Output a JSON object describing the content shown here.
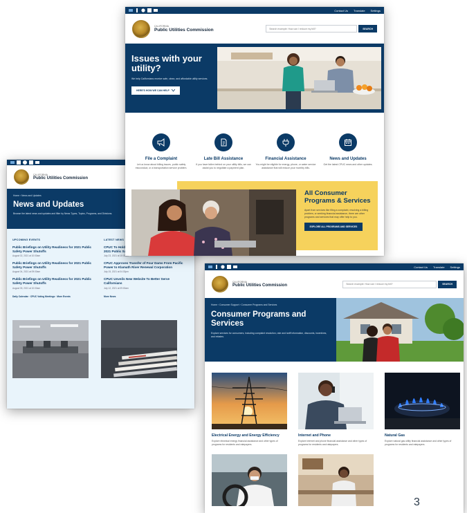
{
  "page_number": "3",
  "brand": {
    "state": "CALIFORNIA",
    "name": "Public Utilities Commission"
  },
  "utility_links": [
    "Contact Us",
    "Translate",
    "Settings"
  ],
  "search": {
    "placeholder": "Search example: How can I reduce my bill?",
    "button": "SEARCH"
  },
  "home": {
    "hero_title": "Issues with your utility?",
    "hero_text": "We help Californians receive safe, clean, and affordable utility services.",
    "hero_cta": "HERE'S HOW WE CAN HELP",
    "features": [
      {
        "icon": "megaphone-icon",
        "title": "File a Complaint",
        "desc": "Let us know about billing issues, public safety misconduct, or a transportation service problem."
      },
      {
        "icon": "document-icon",
        "title": "Late Bill Assistance",
        "desc": "If you have fallen behind on your utility bills, we can assist you to negotiate a payment plan."
      },
      {
        "icon": "plug-icon",
        "title": "Financial Assistance",
        "desc": "You might be eligible for energy, phone, or water service assistance that will reduce your monthly bills."
      },
      {
        "icon": "calendar-icon",
        "title": "News and Updates",
        "desc": "Get the latest CPUC news and other updates."
      }
    ],
    "consumer_title": "All Consumer Programs & Services",
    "consumer_text": "Apart from services like filing a complaint, resolving a billing problem, or seeking financial assistance, there are other programs and services that may offer help to you.",
    "consumer_cta": "EXPLORE ALL PROGRAMS AND SERVICES"
  },
  "news": {
    "breadcrumb": "Home  ›  News and Updates",
    "title": "News and Updates",
    "subtitle": "Browse the latest news and updates and filter by News Types, Topics, Programs, and Divisions.",
    "upcoming_head": "UPCOMING EVENTS",
    "upcoming": [
      {
        "title": "Public Briefings on Utility Readiness for 2021 Public Safety Power Shutoffs",
        "date": "August 02, 2021 at 10:00am"
      },
      {
        "title": "Public Briefings on Utility Readiness for 2021 Public Safety Power Shutoffs",
        "date": "August 04, 2021 at 09:00am"
      },
      {
        "title": "Public Briefings on Utility Readiness for 2021 Public Safety Power Shutoffs",
        "date": "August 05, 2021 at 10:00am"
      }
    ],
    "upcoming_links": "Daily Calendar  ·  CPUC Voting Meetings  ·  More Events",
    "latest_head": "LATEST NEWS",
    "latest": [
      {
        "title": "CPUC To Hold Public Briefings on Utility Readiness for 2021 Public Safety Power Shutoffs",
        "date": "July 23, 2021 at 10:30am"
      },
      {
        "title": "CPUC Approves Transfer of Four Dams From Pacific Power to Klamath River Renewal Corporation",
        "date": "July 15, 2021 at 04:30pm"
      },
      {
        "title": "CPUC Unveils New Website To Better Serve Californians",
        "date": "July 12, 2021 at 09:00am"
      }
    ],
    "more": "More News"
  },
  "programs": {
    "breadcrumb": "Home  ›  Consumer Support  ›  Consumer Programs and Services",
    "title": "Consumer Programs and Services",
    "subtitle": "Explore services for consumers, including complaint resolution, rate and tariff information, discounts, incentives, and rebates.",
    "cards": [
      {
        "title": "Electrical Energy and Energy Efficiency",
        "desc": "Explore electrical energy financial assistance and other types of programs for residents and ratepayers."
      },
      {
        "title": "Internet and Phone",
        "desc": "Explore internet and phone financial assistance and other types of programs for residents and ratepayers."
      },
      {
        "title": "Natural Gas",
        "desc": "Explore natural gas utility financial assistance and other types of programs for residents and ratepayers."
      }
    ]
  },
  "colors": {
    "navy": "#0b3a66",
    "yellow": "#f6d25c",
    "light_blue": "#e9f4fb"
  }
}
